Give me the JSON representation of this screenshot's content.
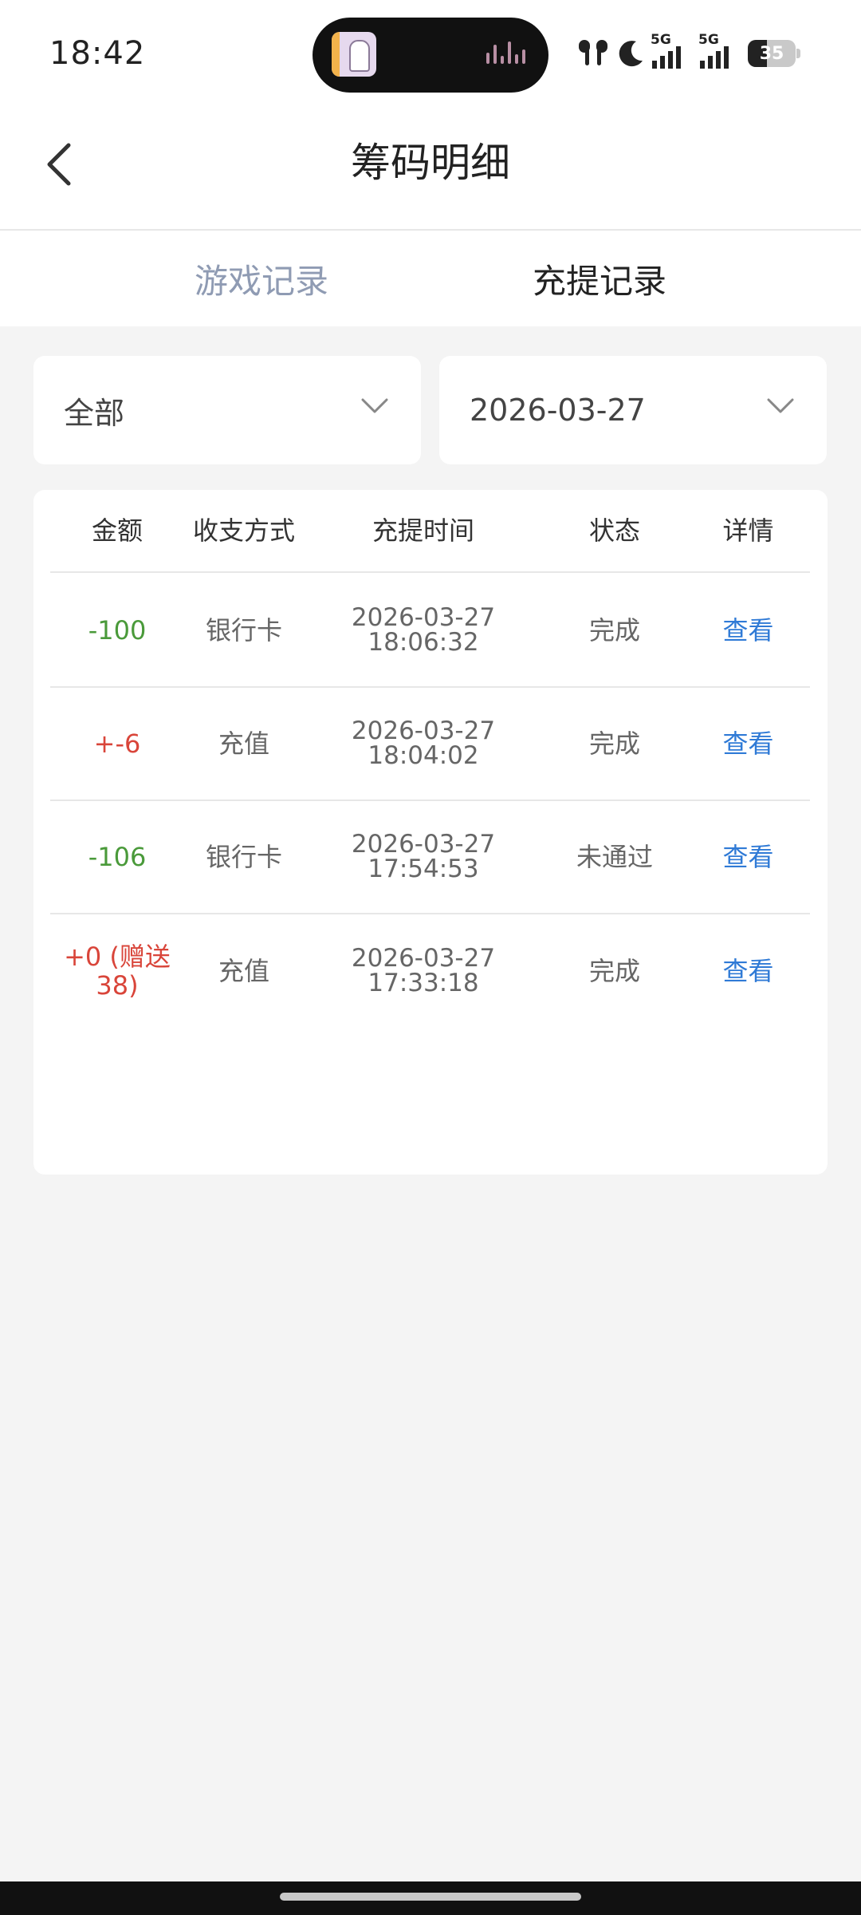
{
  "status_bar": {
    "time": "18:42",
    "signal_1_label": "5G",
    "signal_2_label": "5G",
    "battery_level": "35",
    "icons": [
      "music-island-icon",
      "earbuds-icon",
      "moon-icon",
      "signal-5g-icon",
      "signal-5g-icon",
      "battery-icon"
    ]
  },
  "header": {
    "title": "筹码明细",
    "back_icon": "chevron-left-icon"
  },
  "tabs": [
    {
      "label": "游戏记录",
      "active": false
    },
    {
      "label": "充提记录",
      "active": true
    }
  ],
  "filters": {
    "type": {
      "value": "全部"
    },
    "date": {
      "value": "2026-03-27"
    }
  },
  "table": {
    "headers": [
      "金额",
      "收支方式",
      "充提时间",
      "状态",
      "详情"
    ],
    "rows": [
      {
        "amount": "-100",
        "amount_color": "#4a9a3a",
        "method": "银行卡",
        "date": "2026-03-27",
        "time": "18:06:32",
        "status": "完成",
        "detail": "查看"
      },
      {
        "amount": "+-6",
        "amount_color": "#d9453a",
        "method": "充值",
        "date": "2026-03-27",
        "time": "18:04:02",
        "status": "完成",
        "detail": "查看"
      },
      {
        "amount": "-106",
        "amount_color": "#4a9a3a",
        "method": "银行卡",
        "date": "2026-03-27",
        "time": "17:54:53",
        "status": "未通过",
        "detail": "查看"
      },
      {
        "amount": "+0 (赠送38)",
        "amount_color": "#d9453a",
        "method": "充值",
        "date": "2026-03-27",
        "time": "17:33:18",
        "status": "完成",
        "detail": "查看"
      }
    ]
  },
  "colors": {
    "link": "#2f7ad6",
    "tab_inactive": "#8f9bb3",
    "background": "#f4f4f4"
  }
}
